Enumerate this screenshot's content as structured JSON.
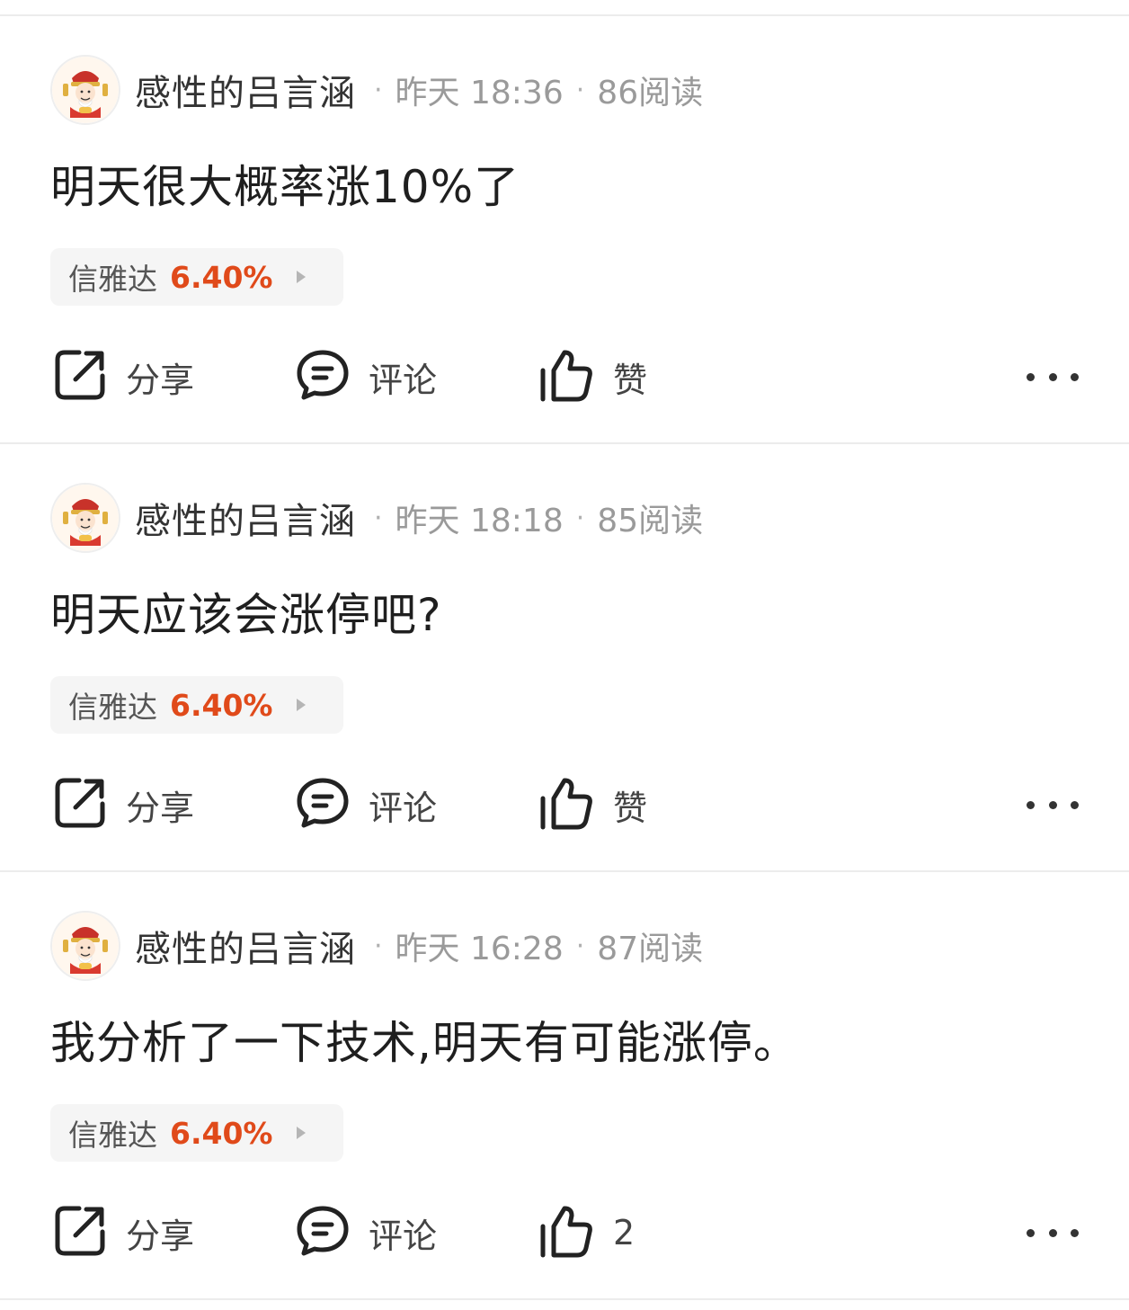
{
  "posts": [
    {
      "author": "感性的吕言涵",
      "time": "昨天 18:36",
      "reads": "86阅读",
      "text": "明天很大概率涨10%了",
      "stock": {
        "name": "信雅达",
        "change": "6.40%"
      },
      "actions": {
        "share": "分享",
        "comment": "评论",
        "like": "赞"
      }
    },
    {
      "author": "感性的吕言涵",
      "time": "昨天 18:18",
      "reads": "85阅读",
      "text": "明天应该会涨停吧?",
      "stock": {
        "name": "信雅达",
        "change": "6.40%"
      },
      "actions": {
        "share": "分享",
        "comment": "评论",
        "like": "赞"
      }
    },
    {
      "author": "感性的吕言涵",
      "time": "昨天 16:28",
      "reads": "87阅读",
      "text": "我分析了一下技术,明天有可能涨停。",
      "stock": {
        "name": "信雅达",
        "change": "6.40%"
      },
      "actions": {
        "share": "分享",
        "comment": "评论",
        "like": "2"
      }
    }
  ],
  "meta_separator": "·",
  "icons": {
    "share": "share-icon",
    "comment": "comment-icon",
    "like": "thumbs-up-icon",
    "more": "more-dots-icon",
    "stock_arrow": "triangle-right-icon"
  },
  "colors": {
    "stock_change": "#e04a1a",
    "divider": "#ececec"
  }
}
